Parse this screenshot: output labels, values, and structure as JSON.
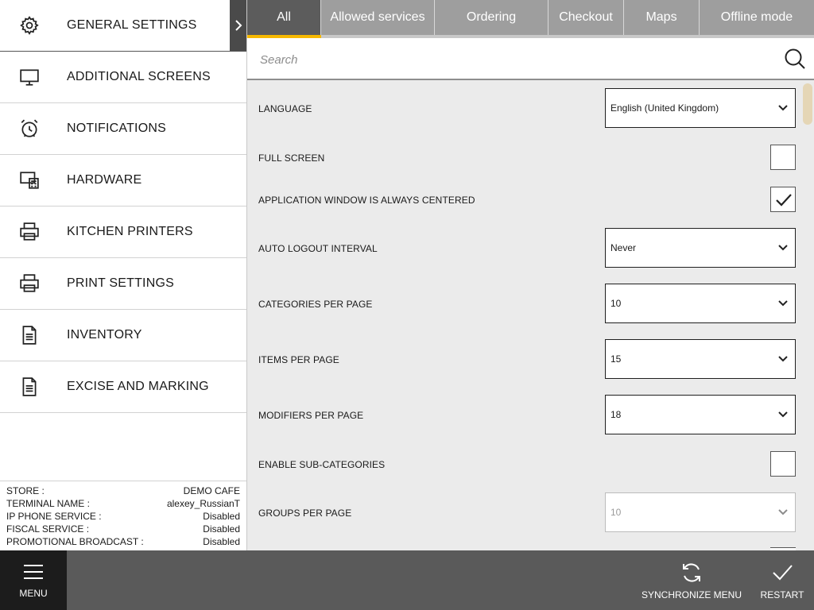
{
  "sidebar": {
    "items": [
      {
        "label": "GENERAL SETTINGS",
        "icon": "gear-icon"
      },
      {
        "label": "ADDITIONAL SCREENS",
        "icon": "monitor-icon"
      },
      {
        "label": "NOTIFICATIONS",
        "icon": "alarm-clock-icon"
      },
      {
        "label": "HARDWARE",
        "icon": "hardware-icon"
      },
      {
        "label": "KITCHEN PRINTERS",
        "icon": "printer-icon"
      },
      {
        "label": "PRINT SETTINGS",
        "icon": "printer-icon"
      },
      {
        "label": "INVENTORY",
        "icon": "document-icon"
      },
      {
        "label": "EXCISE AND MARKING",
        "icon": "document-icon"
      }
    ],
    "info": [
      {
        "key": "STORE :",
        "value": "DEMO CAFE"
      },
      {
        "key": "TERMINAL NAME :",
        "value": "alexey_RussianT"
      },
      {
        "key": "IP PHONE SERVICE :",
        "value": "Disabled"
      },
      {
        "key": "FISCAL SERVICE :",
        "value": "Disabled"
      },
      {
        "key": "PROMOTIONAL BROADCAST :",
        "value": "Disabled"
      }
    ]
  },
  "tabs": [
    {
      "label": "All",
      "active": true
    },
    {
      "label": "Allowed services"
    },
    {
      "label": "Ordering"
    },
    {
      "label": "Checkout"
    },
    {
      "label": "Maps"
    },
    {
      "label": "Offline mode"
    }
  ],
  "search": {
    "placeholder": "Search",
    "value": ""
  },
  "settings": [
    {
      "label": "LANGUAGE",
      "type": "select",
      "value": "English (United Kingdom)"
    },
    {
      "label": "FULL SCREEN",
      "type": "checkbox",
      "checked": false
    },
    {
      "label": "APPLICATION WINDOW IS ALWAYS CENTERED",
      "type": "checkbox",
      "checked": true
    },
    {
      "label": "AUTO LOGOUT INTERVAL",
      "type": "select",
      "value": "Never"
    },
    {
      "label": "CATEGORIES PER PAGE",
      "type": "select",
      "value": "10"
    },
    {
      "label": "ITEMS PER PAGE",
      "type": "select",
      "value": "15"
    },
    {
      "label": "MODIFIERS PER PAGE",
      "type": "select",
      "value": "18"
    },
    {
      "label": "ENABLE SUB-CATEGORIES",
      "type": "checkbox",
      "checked": false
    },
    {
      "label": "GROUPS PER PAGE",
      "type": "select",
      "value": "10",
      "disabled": true
    }
  ],
  "bottombar": {
    "menu_label": "MENU",
    "sync_label": "SYNCHRONIZE MENU",
    "restart_label": "RESTART"
  },
  "colors": {
    "accent": "#f6b800",
    "tab_active": "#5c5c5c",
    "tab_inactive": "#9e9e9e",
    "bottombar": "#5a5a5a",
    "menu_button": "#1c1c1c"
  }
}
